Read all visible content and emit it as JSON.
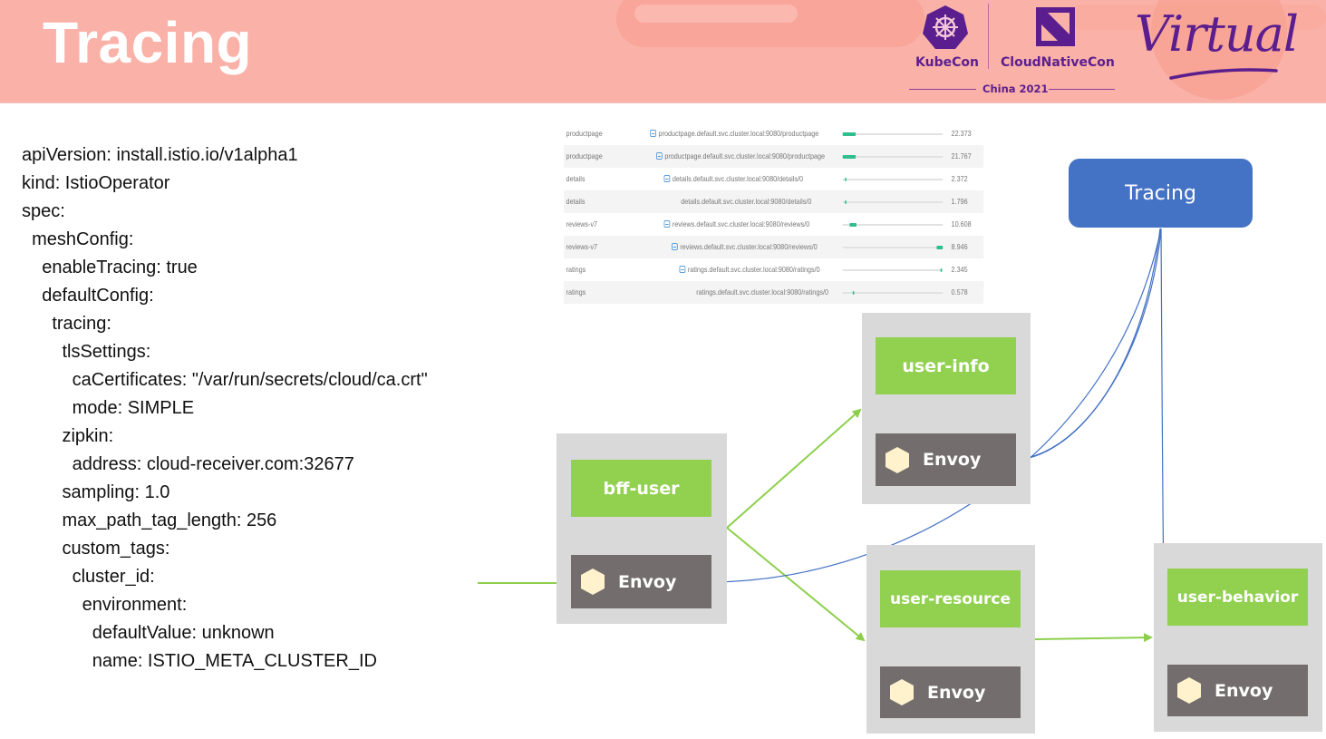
{
  "slide": {
    "title": "Tracing"
  },
  "branding": {
    "kubecon": "KubeCon",
    "cloudnativecon": "CloudNativeCon",
    "event": "China 2021",
    "edition": "Virtual",
    "accent_color": "#5b1e8e",
    "banner_color": "#fab1a8"
  },
  "yaml": {
    "lines": [
      "apiVersion: install.istio.io/v1alpha1",
      "kind: IstioOperator",
      "spec:",
      "  meshConfig:",
      "    enableTracing: true",
      "    defaultConfig:",
      "      tracing:",
      "        tlsSettings:",
      "          caCertificates: \"/var/run/secrets/cloud/ca.crt\"",
      "          mode: SIMPLE",
      "        zipkin:",
      "          address: cloud-receiver.com:32677",
      "        sampling: 1.0",
      "        max_path_tag_length: 256",
      "        custom_tags:",
      "          cluster_id:",
      "            environment:",
      "              defaultValue: unknown",
      "              name: ISTIO_META_CLUSTER_ID"
    ]
  },
  "trace_table": {
    "rows": [
      {
        "service": "productpage",
        "operation": "productpage.default.svc.cluster.local:9080/productpage",
        "has_toggle": true,
        "depth": 0,
        "bar_start": 0.0,
        "bar_width": 0.13,
        "duration": "22.373"
      },
      {
        "service": "productpage",
        "operation": "productpage.default.svc.cluster.local:9080/productpage",
        "has_toggle": true,
        "depth": 1,
        "bar_start": 0.0,
        "bar_width": 0.13,
        "duration": "21.767"
      },
      {
        "service": "details",
        "operation": "details.default.svc.cluster.local:9080/details/0",
        "has_toggle": true,
        "depth": 2,
        "bar_start": 0.02,
        "bar_width": 0.02,
        "duration": "2.372"
      },
      {
        "service": "details",
        "operation": "details.default.svc.cluster.local:9080/details/0",
        "has_toggle": false,
        "depth": 3,
        "bar_start": 0.02,
        "bar_width": 0.015,
        "duration": "1.796"
      },
      {
        "service": "reviews-v7",
        "operation": "reviews.default.svc.cluster.local:9080/reviews/0",
        "has_toggle": true,
        "depth": 2,
        "bar_start": 0.07,
        "bar_width": 0.07,
        "duration": "10.608"
      },
      {
        "service": "reviews-v7",
        "operation": "reviews.default.svc.cluster.local:9080/reviews/0",
        "has_toggle": true,
        "depth": 3,
        "bar_start": 0.94,
        "bar_width": 0.06,
        "duration": "8.946"
      },
      {
        "service": "ratings",
        "operation": "ratings.default.svc.cluster.local:9080/ratings/0",
        "has_toggle": true,
        "depth": 4,
        "bar_start": 0.98,
        "bar_width": 0.015,
        "duration": "2.345"
      },
      {
        "service": "ratings",
        "operation": "ratings.default.svc.cluster.local:9080/ratings/0",
        "has_toggle": false,
        "depth": 5,
        "bar_start": 0.1,
        "bar_width": 0.008,
        "duration": "0.578"
      }
    ]
  },
  "diagram": {
    "tracing_label": "Tracing",
    "sidecar_label": "Envoy",
    "services": [
      {
        "id": "bff-user",
        "label": "bff-user"
      },
      {
        "id": "user-info",
        "label": "user-info"
      },
      {
        "id": "user-resource",
        "label": "user-resource"
      },
      {
        "id": "user-behavior",
        "label": "user-behavior"
      }
    ],
    "colors": {
      "service": "#92d050",
      "sidecar": "#736e6d",
      "pod": "#d9d9d9",
      "tracing": "#4472c4",
      "request_arrow": "#8dcf4c",
      "trace_line": "#4472c4",
      "hexagon": "#fff2cc"
    }
  }
}
